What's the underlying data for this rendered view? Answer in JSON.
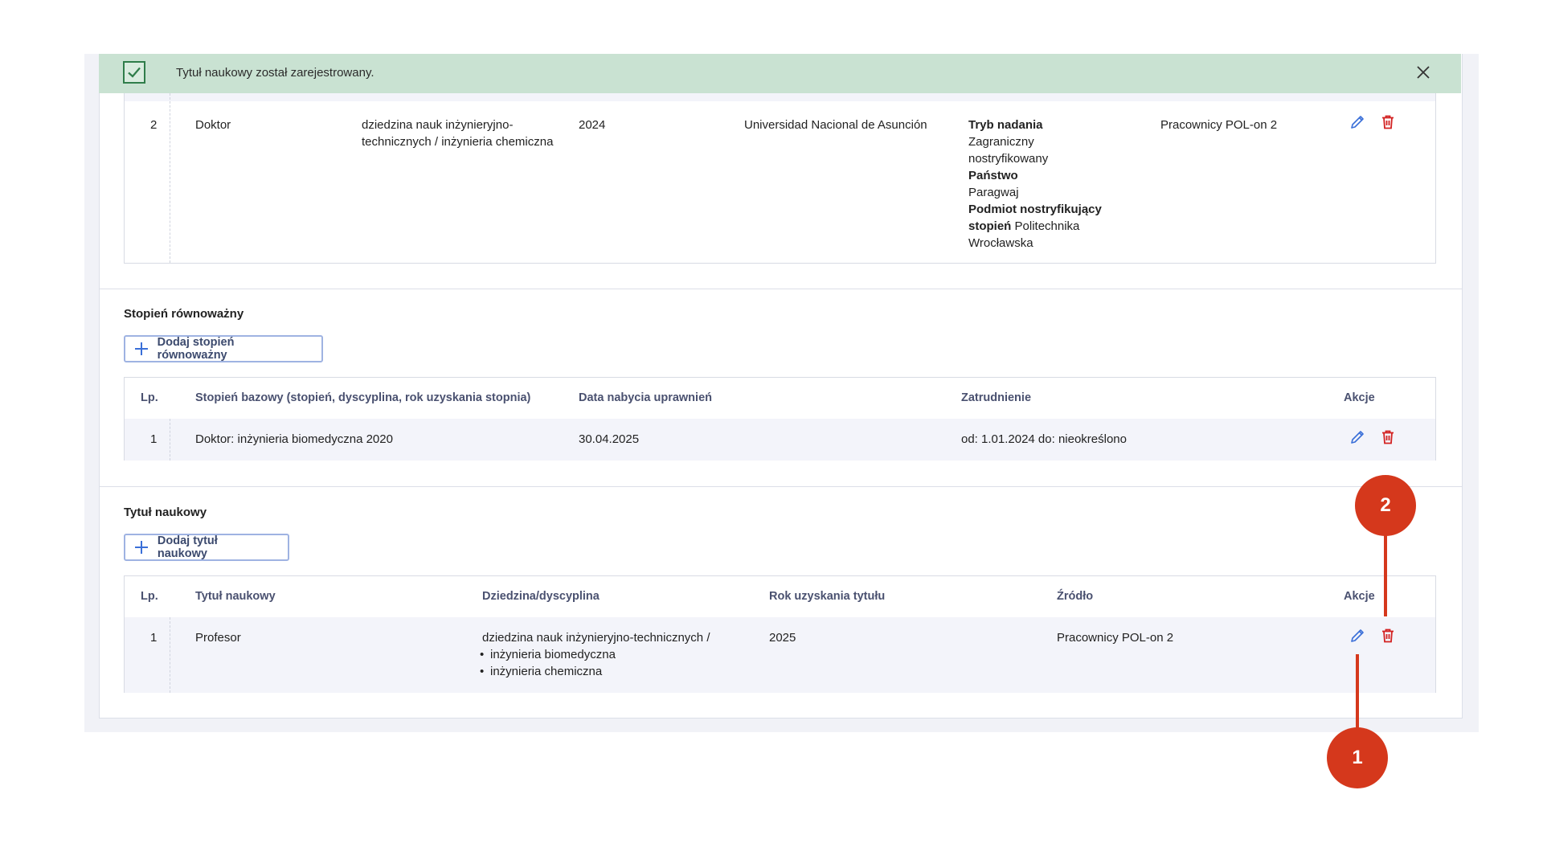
{
  "alert": {
    "message": "Tytuł naukowy został zarejestrowany."
  },
  "degree_row": {
    "lp": "2",
    "stopien": "Doktor",
    "dziedzina_line1": "dziedzina nauk inżynieryjno-",
    "dziedzina_line2": "technicznych / inżynieria chemiczna",
    "rok": "2024",
    "uczelnia": "Universidad Nacional de Asunción",
    "tryb_label": "Tryb nadania",
    "tryb_value_line1": "Zagraniczny",
    "tryb_value_line2": "nostryfikowany",
    "panstwo_label": "Państwo",
    "panstwo_value": "Paragwaj",
    "podmiot_label_line1": "Podmiot nostryfikujący",
    "podmiot_label_line2": "stopień",
    "podmiot_value_inline": "Politechnika",
    "podmiot_value_line2": "Wrocławska",
    "zrodlo": "Pracownicy POL-on 2"
  },
  "equivalent": {
    "title": "Stopień równoważny",
    "add_button": "Dodaj stopień równoważny",
    "headers": {
      "lp": "Lp.",
      "base": "Stopień bazowy (stopień, dyscyplina, rok uzyskania stopnia)",
      "date": "Data nabycia uprawnień",
      "employment": "Zatrudnienie",
      "actions": "Akcje"
    },
    "rows": [
      {
        "lp": "1",
        "base": "Doktor: inżynieria biomedyczna 2020",
        "date": "30.04.2025",
        "employment": "od: 1.01.2024 do: nieokreślono"
      }
    ]
  },
  "title_section": {
    "title": "Tytuł naukowy",
    "add_button": "Dodaj tytuł naukowy",
    "headers": {
      "lp": "Lp.",
      "title": "Tytuł naukowy",
      "field": "Dziedzina/dyscyplina",
      "year": "Rok uzyskania tytułu",
      "source": "Źródło",
      "actions": "Akcje"
    },
    "rows": [
      {
        "lp": "1",
        "title": "Profesor",
        "field": "dziedzina nauk inżynieryjno-technicznych /",
        "disciplines": [
          "inżynieria biomedyczna",
          "inżynieria chemiczna"
        ],
        "year": "2025",
        "source": "Pracownicy POL-on 2"
      }
    ]
  },
  "markers": {
    "m1": "1",
    "m2": "2"
  },
  "colors": {
    "edit": "#3a6fd8",
    "delete": "#d32222",
    "marker": "#d5381c",
    "alert_bg": "#c9e2d2"
  }
}
